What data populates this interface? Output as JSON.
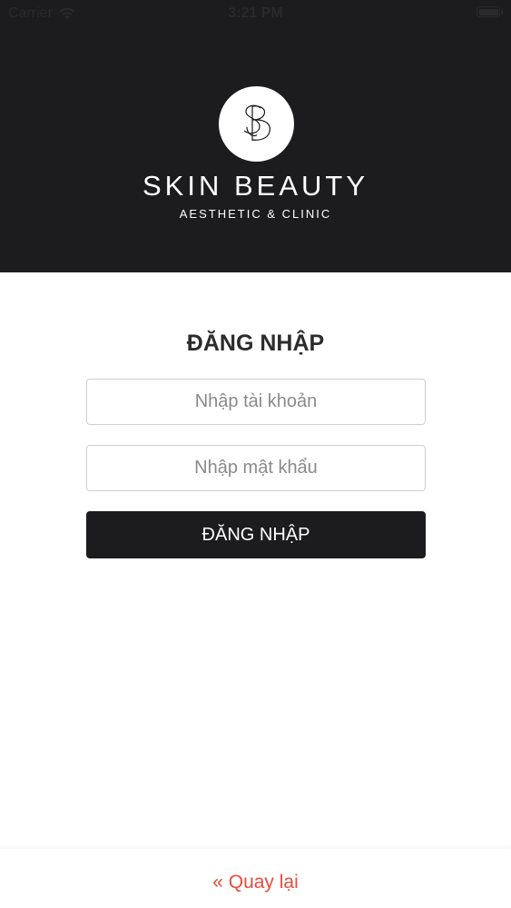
{
  "status_bar": {
    "carrier": "Carrier",
    "time": "3:21 PM"
  },
  "brand": {
    "title": "SKIN BEAUTY",
    "subtitle": "AESTHETIC & CLINIC"
  },
  "login": {
    "heading": "ĐĂNG NHẬP",
    "username_placeholder": "Nhập tài khoản",
    "password_placeholder": "Nhập mật khẩu",
    "submit_label": "ĐĂNG NHẬP"
  },
  "footer": {
    "back_label": "« Quay lại"
  },
  "colors": {
    "header_bg": "#1c1b1d",
    "button_bg": "#1c1b1d",
    "link": "#e74c3c"
  }
}
